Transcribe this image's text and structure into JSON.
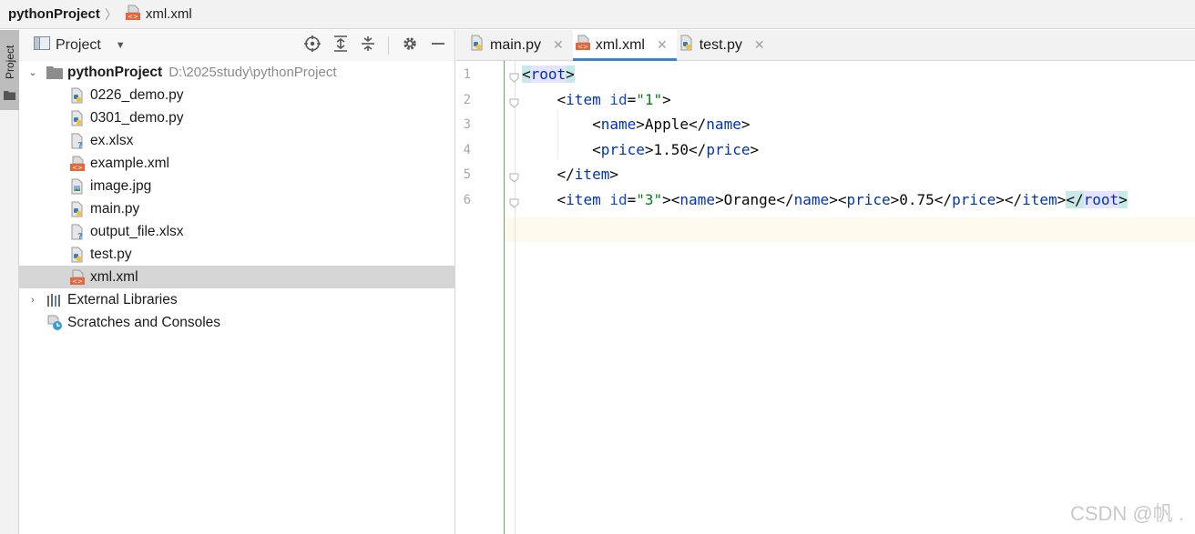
{
  "breadcrumb": {
    "project": "pythonProject",
    "file": "xml.xml"
  },
  "sidestrip": {
    "tab_label": "Project"
  },
  "project_panel": {
    "title": "Project",
    "tree": {
      "root_name": "pythonProject",
      "root_path": "D:\\2025study\\pythonProject",
      "files": [
        {
          "name": "0226_demo.py",
          "icon": "python-file-icon"
        },
        {
          "name": "0301_demo.py",
          "icon": "python-file-icon"
        },
        {
          "name": "ex.xlsx",
          "icon": "unknown-file-icon"
        },
        {
          "name": "example.xml",
          "icon": "xml-file-icon"
        },
        {
          "name": "image.jpg",
          "icon": "image-file-icon"
        },
        {
          "name": "main.py",
          "icon": "python-file-icon"
        },
        {
          "name": "output_file.xlsx",
          "icon": "unknown-file-icon"
        },
        {
          "name": "test.py",
          "icon": "python-file-icon"
        },
        {
          "name": "xml.xml",
          "icon": "xml-file-icon"
        }
      ],
      "selected": "xml.xml",
      "external_libraries": "External Libraries",
      "scratches": "Scratches and Consoles"
    }
  },
  "editor": {
    "tabs": [
      {
        "label": "main.py",
        "active": false
      },
      {
        "label": "xml.xml",
        "active": true
      },
      {
        "label": "test.py",
        "active": false
      }
    ],
    "line_numbers": [
      "1",
      "2",
      "3",
      "4",
      "5",
      "6"
    ],
    "lines": [
      {
        "parts": [
          [
            "p",
            "<"
          ],
          [
            "t",
            "root"
          ],
          [
            "p",
            ">"
          ]
        ]
      },
      {
        "parts": [
          [
            "p",
            "    <"
          ],
          [
            "t",
            "item"
          ],
          [
            "p",
            " "
          ],
          [
            "a",
            "id"
          ],
          [
            "p",
            "="
          ],
          [
            "s",
            "\"1\""
          ],
          [
            "p",
            ">"
          ]
        ]
      },
      {
        "parts": [
          [
            "p",
            "        <"
          ],
          [
            "t",
            "name"
          ],
          [
            "p",
            ">Apple</"
          ],
          [
            "t",
            "name"
          ],
          [
            "p",
            ">"
          ]
        ]
      },
      {
        "parts": [
          [
            "p",
            "        <"
          ],
          [
            "t",
            "price"
          ],
          [
            "p",
            ">1.50</"
          ],
          [
            "t",
            "price"
          ],
          [
            "p",
            ">"
          ]
        ]
      },
      {
        "parts": [
          [
            "p",
            "    </"
          ],
          [
            "t",
            "item"
          ],
          [
            "p",
            ">"
          ]
        ]
      },
      {
        "parts": [
          [
            "p",
            "    <"
          ],
          [
            "t",
            "item"
          ],
          [
            "p",
            " "
          ],
          [
            "a",
            "id"
          ],
          [
            "p",
            "="
          ],
          [
            "s",
            "\"3\""
          ],
          [
            "p",
            "><"
          ],
          [
            "t",
            "name"
          ],
          [
            "p",
            ">Orange</"
          ],
          [
            "t",
            "name"
          ],
          [
            "p",
            "><"
          ],
          [
            "t",
            "price"
          ],
          [
            "p",
            ">0.75</"
          ],
          [
            "t",
            "price"
          ],
          [
            "p",
            "></"
          ],
          [
            "t",
            "item"
          ],
          [
            "p",
            "></"
          ],
          [
            "t",
            "root"
          ],
          [
            "p",
            ">"
          ]
        ]
      }
    ],
    "current_line": 6
  },
  "watermark": "CSDN @帆 ."
}
